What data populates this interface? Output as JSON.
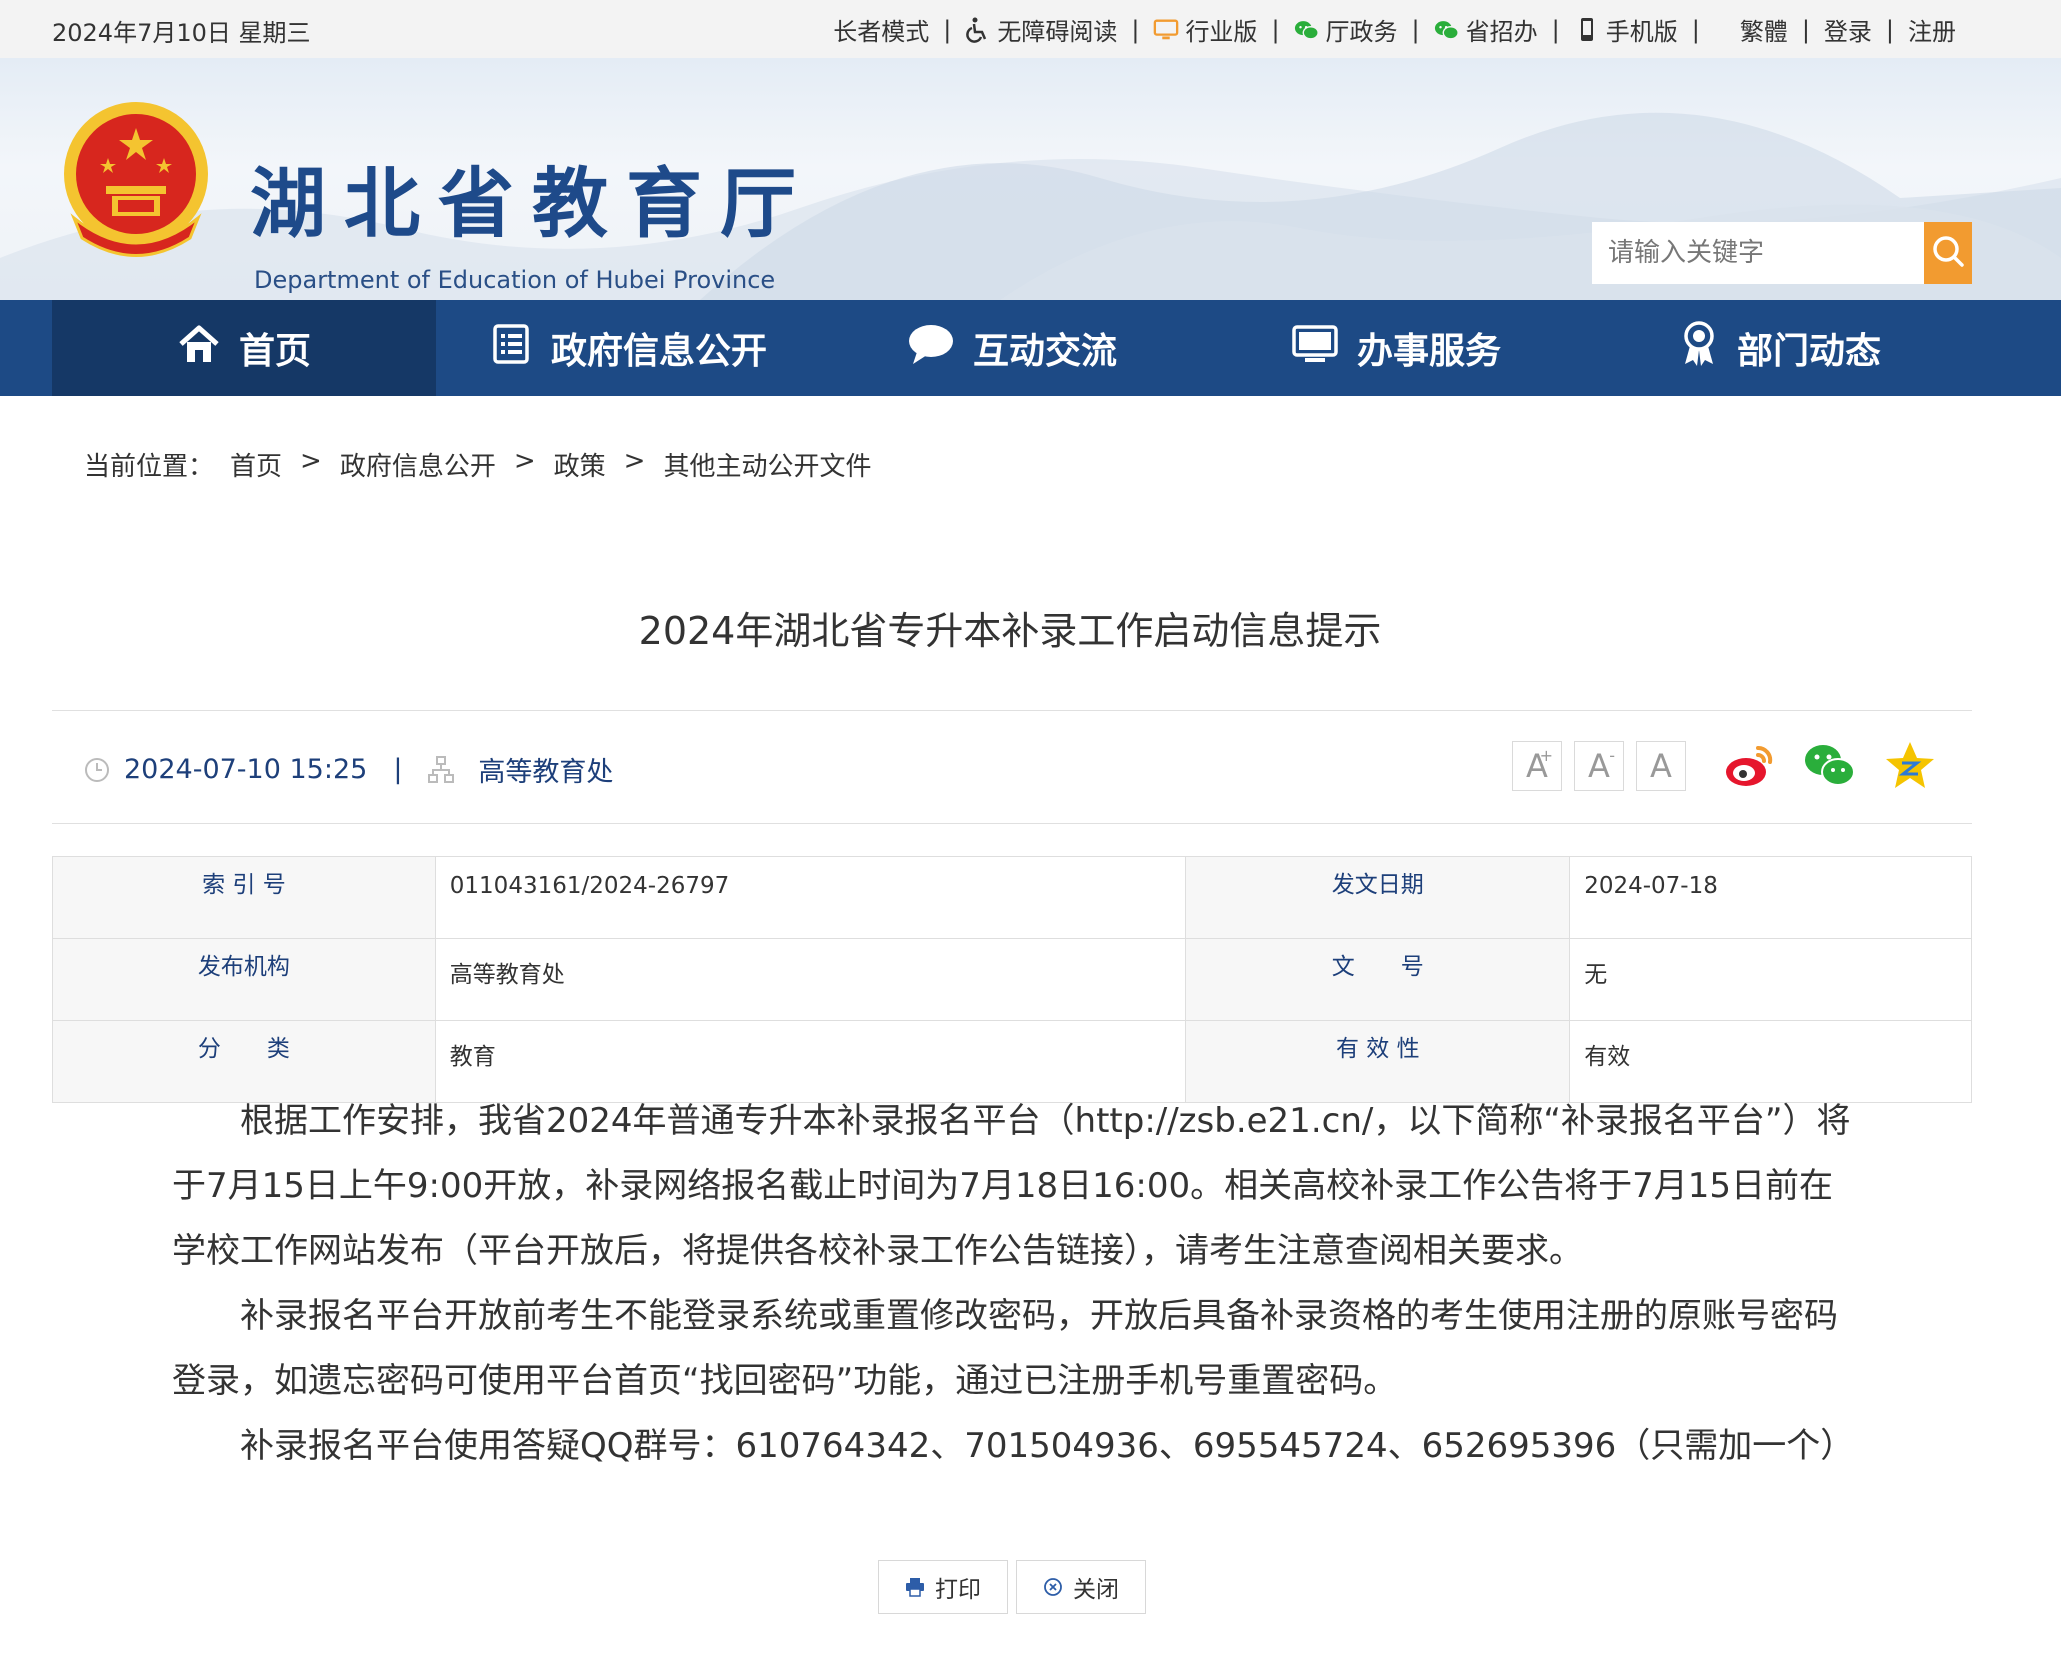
{
  "topbar": {
    "date": "2024年7月10日 星期三",
    "links": [
      {
        "label": "长者模式",
        "icon": ""
      },
      {
        "label": "无障碍阅读",
        "icon": "wheelchair-icon"
      },
      {
        "label": "行业版",
        "icon": "monitor-icon"
      },
      {
        "label": "厅政务",
        "icon": "wechat-icon"
      },
      {
        "label": "省招办",
        "icon": "wechat-icon"
      },
      {
        "label": "手机版",
        "icon": "mobile-phone-icon"
      },
      {
        "label": "繁體",
        "icon": ""
      },
      {
        "label": "登录",
        "icon": ""
      },
      {
        "label": "注册",
        "icon": ""
      }
    ]
  },
  "header": {
    "title": "湖北省教育厅",
    "subtitle": "Department of Education of Hubei Province",
    "search_placeholder": "请输入关键字"
  },
  "nav": {
    "items": [
      {
        "label": "首页",
        "icon": "home-icon"
      },
      {
        "label": "政府信息公开",
        "icon": "document-list-icon"
      },
      {
        "label": "互动交流",
        "icon": "chat-bubble-icon"
      },
      {
        "label": "办事服务",
        "icon": "monitor-icon"
      },
      {
        "label": "部门动态",
        "icon": "badge-icon"
      }
    ]
  },
  "breadcrumb": {
    "label": "当前位置：",
    "items": [
      "首页",
      "政府信息公开",
      "政策",
      "其他主动公开文件"
    ],
    "separator": ">"
  },
  "article": {
    "title": "2024年湖北省专升本补录工作启动信息提示",
    "datetime": "2024-07-10 15:25",
    "meta_separator": "|",
    "department": "高等教育处",
    "font_buttons": {
      "large": "A",
      "small": "A",
      "normal": "A",
      "plus": "+",
      "minus": "-"
    },
    "info_table": [
      {
        "label1": "索 引 号",
        "value1": "011043161/2024-26797",
        "label2": "发文日期",
        "value2": "2024-07-18"
      },
      {
        "label1": "发布机构",
        "value1": "高等教育处",
        "label2": "文　　号",
        "value2": "无"
      },
      {
        "label1": "分　　类",
        "value1": "教育",
        "label2": "有 效 性",
        "value2": "有效"
      }
    ],
    "paragraphs": [
      "根据工作安排，我省2024年普通专升本补录报名平台（http://zsb.e21.cn/，以下简称“补录报名平台”）将于7月15日上午9:00开放，补录网络报名截止时间为7月18日16:00。相关高校补录工作公告将于7月15日前在学校工作网站发布（平台开放后，将提供各校补录工作公告链接），请考生注意查阅相关要求。",
      "补录报名平台开放前考生不能登录系统或重置修改密码，开放后具备补录资格的考生使用注册的原账号密码登录，如遗忘密码可使用平台首页“找回密码”功能，通过已注册手机号重置密码。",
      "补录报名平台使用答疑QQ群号：610764342、701504936、695545724、652695396（只需加一个）"
    ]
  },
  "actions": {
    "print": "打印",
    "close": "关闭"
  },
  "colors": {
    "nav_bg": "#1d4a85",
    "nav_active": "#153866",
    "search_btn": "#f29b30",
    "title_blue": "#1e4a8a"
  }
}
